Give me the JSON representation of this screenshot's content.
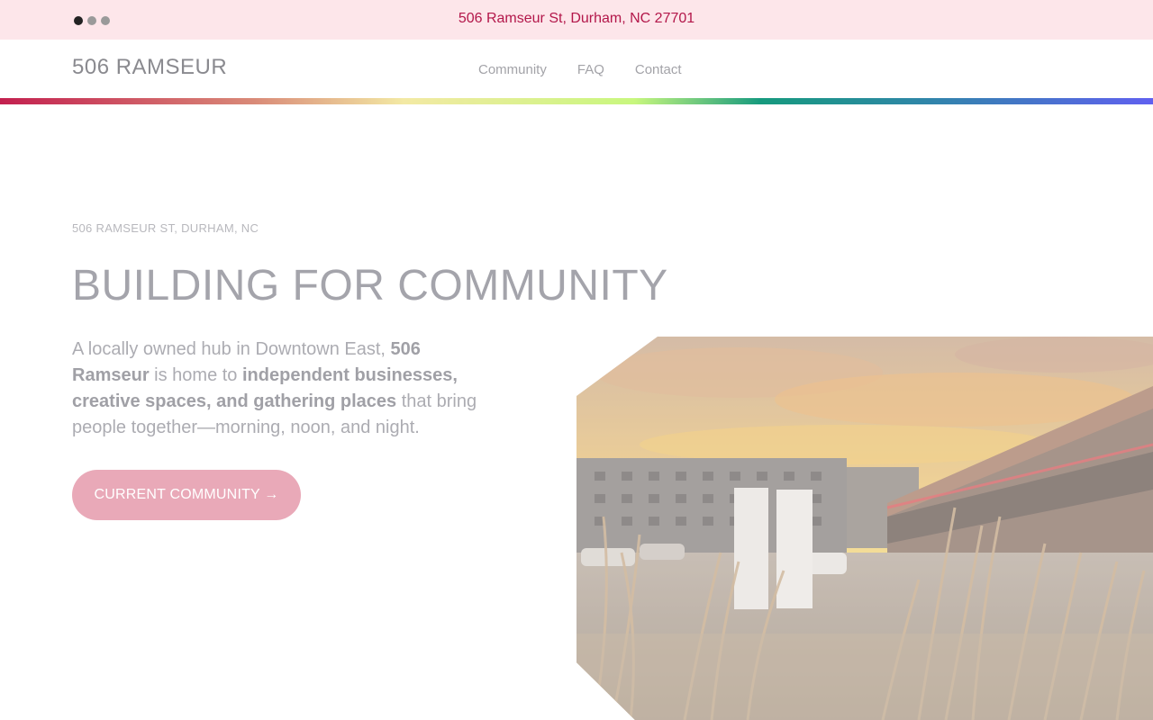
{
  "topbar": {
    "carousel_dots": 3,
    "address": "506 Ramseur St, Durham, NC 27701"
  },
  "navbar": {
    "brand": "506 RAMSEUR",
    "links": [
      "Community",
      "FAQ",
      "Contact"
    ]
  },
  "hero": {
    "eyebrow": "506 RAMSEUR ST, DURHAM, NC",
    "headline": "BUILDING FOR COMMUNITY",
    "intro": {
      "p1": "A locally owned hub in Downtown East, ",
      "b1": "506 Ramseur",
      "p2": " is home to ",
      "b2": "independent businesses, creative spaces, and gathering places",
      "p3": " that bring people together—morning, noon, and night."
    },
    "cta_label": "CURRENT COMMUNITY →"
  },
  "colors": {
    "topbar_bg": "#fde6ea",
    "address_text": "#b3174a",
    "cta_bg": "#e9a9b8"
  }
}
